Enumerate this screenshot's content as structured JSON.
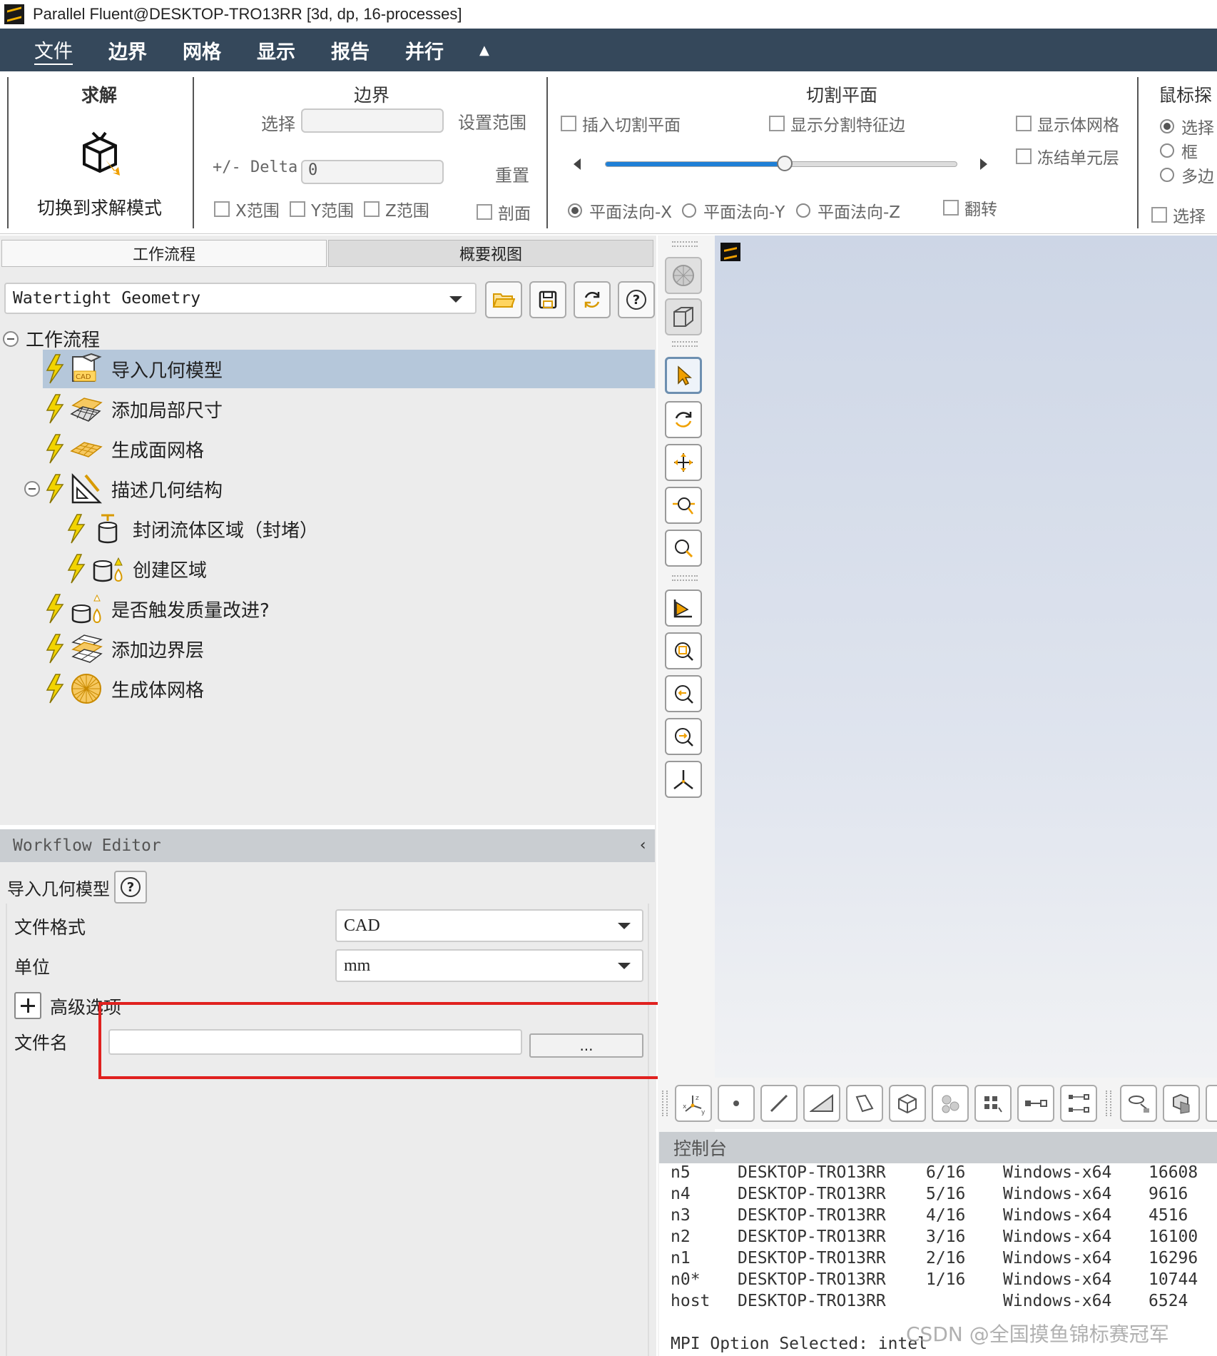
{
  "window": {
    "title": "Parallel Fluent@DESKTOP-TRO13RR  [3d, dp, 16-processes]"
  },
  "menu": {
    "items": [
      "文件",
      "边界",
      "网格",
      "显示",
      "报告",
      "并行"
    ],
    "collapse_icon": "caret-up-icon"
  },
  "ribbon": {
    "solve": {
      "title": "求解",
      "button_label": "切换到求解模式"
    },
    "boundary": {
      "title": "边界",
      "select_label": "选择",
      "set_range_label": "设置范围",
      "delta_label": "+/- Delta",
      "delta_value": "0",
      "reset_label": "重置",
      "x_range": "X范围",
      "y_range": "Y范围",
      "z_range": "Z范围",
      "section": "剖面"
    },
    "cut_plane": {
      "title": "切割平面",
      "insert": "插入切割平面",
      "show_features": "显示分割特征边",
      "show_volume_mesh": "显示体网格",
      "freeze_cells": "冻结单元层",
      "slider_fraction": 0.51,
      "normal_x": "平面法向-X",
      "normal_y": "平面法向-Y",
      "normal_z": "平面法向-Z",
      "flip": "翻转"
    },
    "mouse_probe": {
      "title": "鼠标探",
      "opt_select": "选择",
      "opt_box": "框",
      "opt_polygon": "多边",
      "select_check": "选择"
    }
  },
  "left_panel": {
    "tabs": [
      "工作流程",
      "概要视图"
    ],
    "workflow_type": "Watertight Geometry",
    "tree_root": "工作流程",
    "tree_items": [
      "导入几何模型",
      "添加局部尺寸",
      "生成面网格",
      "描述几何结构",
      "封闭流体区域（封堵）",
      "创建区域",
      "是否触发质量改进?",
      "添加边界层",
      "生成体网格"
    ]
  },
  "workflow_editor": {
    "header": "Workflow Editor",
    "task_title": "导入几何模型",
    "file_format_label": "文件格式",
    "file_format_value": "CAD",
    "unit_label": "单位",
    "unit_value": "mm",
    "advanced_label": "高级选项",
    "filename_label": "文件名",
    "filename_value": "",
    "browse_label": "..."
  },
  "console": {
    "header": "控制台",
    "rows": [
      [
        "n5",
        "DESKTOP-TRO13RR",
        "6/16",
        "Windows-x64",
        "16608"
      ],
      [
        "n4",
        "DESKTOP-TRO13RR",
        "5/16",
        "Windows-x64",
        "9616"
      ],
      [
        "n3",
        "DESKTOP-TRO13RR",
        "4/16",
        "Windows-x64",
        "4516"
      ],
      [
        "n2",
        "DESKTOP-TRO13RR",
        "3/16",
        "Windows-x64",
        "16100"
      ],
      [
        "n1",
        "DESKTOP-TRO13RR",
        "2/16",
        "Windows-x64",
        "16296"
      ],
      [
        "n0*",
        "DESKTOP-TRO13RR",
        "1/16",
        "Windows-x64",
        "10744"
      ],
      [
        "host",
        "DESKTOP-TRO13RR",
        "",
        "Windows-x64",
        "6524"
      ]
    ],
    "last_line": "MPI Option Selected: intel"
  },
  "watermark": "CSDN @全国摸鱼锦标赛冠军",
  "colors": {
    "menubar": "#35485b",
    "selection": "#b5c7da",
    "highlight_box": "#e0211f",
    "bolt": "#f2d400"
  }
}
